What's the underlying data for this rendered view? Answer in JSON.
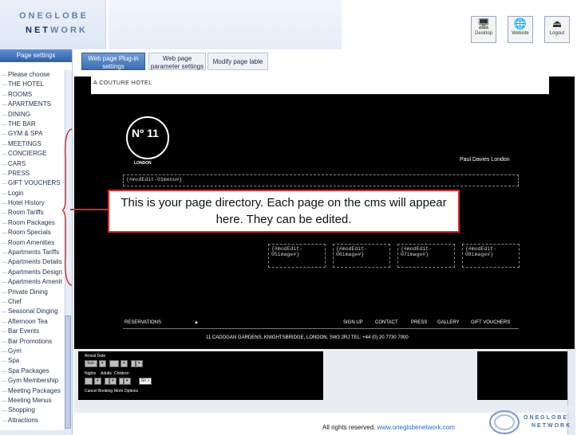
{
  "header": {
    "logo_line1": "ONEGLOBE",
    "logo_line2_bold": "NET",
    "logo_line2_rest": "WORK",
    "toolbar": [
      {
        "label": "Desktop",
        "icon": "desktop-icon",
        "glyph": "🖥"
      },
      {
        "label": "Website",
        "icon": "globe-icon",
        "glyph": "🌐"
      },
      {
        "label": "Logout",
        "icon": "logout-icon",
        "glyph": "⏏"
      }
    ]
  },
  "sidebar": {
    "title": "Page settings",
    "items": [
      "Please choose",
      "THE HOTEL",
      "ROOMS",
      "APARTMENTS",
      "DINING",
      "THE BAR",
      "GYM & SPA",
      "MEETINGS",
      "CONCIERGE",
      "CARS",
      "PRESS",
      "GIFT VOUCHERS",
      "Login",
      "Hotel History",
      "Room Tariffs",
      "Room Packages",
      "Room Specials",
      "Room Amenities",
      "Apartments Tariffs",
      "Apartments Details",
      "Apartments Design",
      "Apartments Amenit",
      "Private Dining",
      "Chef",
      "Seasonal Dinging",
      "Afternoon Tea",
      "Bar Events",
      "Bar Promotions",
      "Gym",
      "Spa",
      "Spa Packages",
      "Gym Membership",
      "Meeting Packages",
      "Meeting Menus",
      "Shopping",
      "Attractions"
    ]
  },
  "tabs": {
    "plugin": "Web page Plug-in settings",
    "param": "Web page parameter settings",
    "modify": "Modify page lable"
  },
  "preview": {
    "top_text": "A COUTURE HOTEL",
    "badge_no": "Nº 11",
    "badge_city": "LONDON",
    "brand": "Paul Davies London",
    "menu_placeholder": "{#modEdit-01menu#}",
    "images": [
      "{#modEdit-05image#}",
      "{#modEdit-06image#}",
      "{#modEdit-07image#}",
      "{#modEdit-08image#}"
    ],
    "reservations": "RESERVATIONS",
    "nav": [
      "SIGN UP",
      "CONTACT",
      "PRESS",
      "GALLERY",
      "GIFT VOUCHERS"
    ],
    "address": "11 CADOGAN GARDENS, KNIGHTSBRIDGE, LONDON, SW3 2RJ TEL: +44 (0) 20 7730 7000",
    "booking": {
      "arrival": "Arrival Date",
      "nights": "Nights",
      "adults": "Adults",
      "children": "Children",
      "go": "Go >",
      "cancel": "Cancel Booking",
      "more": "More Options"
    }
  },
  "callout": {
    "text": "This is your page directory. Each page on the cms will appear here. They can be edited.",
    "color": "#d62b2b"
  },
  "footer": {
    "copyright": "All rights reserved.",
    "link": "www.oneglobenetwork.com",
    "logo_line1": "ONEGLOBE",
    "logo_line2": "NETWORK"
  }
}
